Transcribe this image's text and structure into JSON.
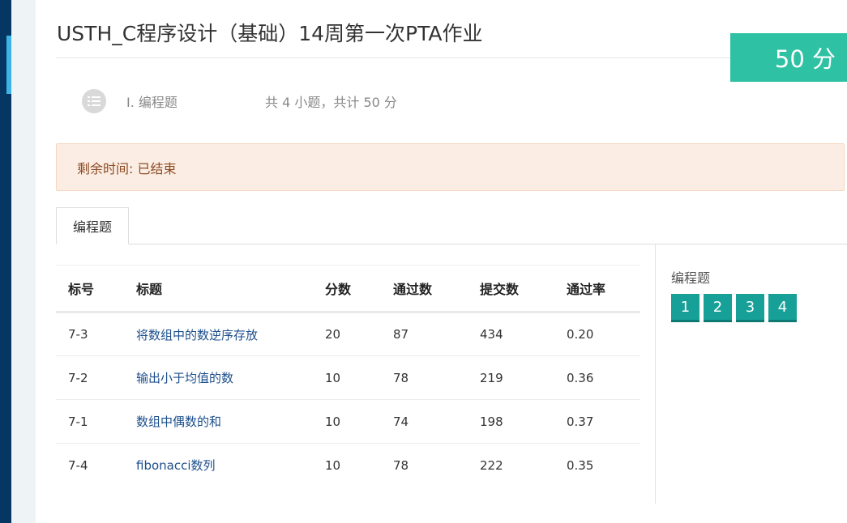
{
  "page": {
    "title": "USTH_C程序设计（基础）14周第一次PTA作业",
    "score_badge": "50 分"
  },
  "section": {
    "icon": "list-icon",
    "name": "I.  编程题",
    "count": "共 4 小题，共计 50 分"
  },
  "timer": {
    "text": "剩余时间: 已结束"
  },
  "tabs": [
    {
      "label": "编程题"
    }
  ],
  "table": {
    "headers": {
      "id": "标号",
      "title": "标题",
      "score": "分数",
      "passed": "通过数",
      "submitted": "提交数",
      "pass_rate": "通过率"
    },
    "rows": [
      {
        "id": "7-3",
        "title": "将数组中的数逆序存放",
        "score": "20",
        "passed": "87",
        "submitted": "434",
        "pass_rate": "0.20"
      },
      {
        "id": "7-2",
        "title": "输出小于均值的数",
        "score": "10",
        "passed": "78",
        "submitted": "219",
        "pass_rate": "0.36"
      },
      {
        "id": "7-1",
        "title": "数组中偶数的和",
        "score": "10",
        "passed": "74",
        "submitted": "198",
        "pass_rate": "0.37"
      },
      {
        "id": "7-4",
        "title": "fibonacci数列",
        "score": "10",
        "passed": "78",
        "submitted": "222",
        "pass_rate": "0.35"
      }
    ]
  },
  "nav_panel": {
    "title": "编程题",
    "buttons": [
      "1",
      "2",
      "3",
      "4"
    ]
  },
  "colors": {
    "sidebar": "#063763",
    "accent": "#3db4e8",
    "score_badge": "#2ec1a3",
    "nav_button": "#17a097",
    "link": "#1c4f8c"
  }
}
